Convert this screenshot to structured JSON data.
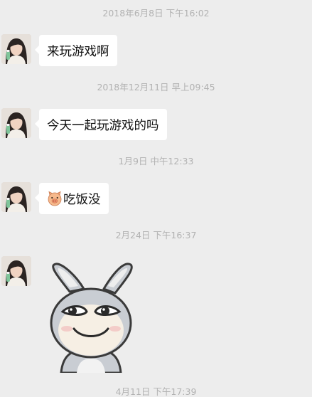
{
  "messages": [
    {
      "timestamp": "2018年6月8日 下午16:02",
      "text": "来玩游戏啊"
    },
    {
      "timestamp": "2018年12月11日 早上09:45",
      "text": "今天一起玩游戏的吗"
    },
    {
      "timestamp": "1月9日 中午12:33",
      "text": "吃饭没",
      "icon": "pig-face-emoji-icon"
    },
    {
      "timestamp": "2月24日 下午16:37",
      "sticker": "bunny-smirk-sticker"
    },
    {
      "timestamp": "4月11日 下午17:39"
    }
  ],
  "colors": {
    "background": "#ededed",
    "bubble": "#ffffff",
    "timestamp_text": "#b2b2b2",
    "message_text": "#111111"
  }
}
